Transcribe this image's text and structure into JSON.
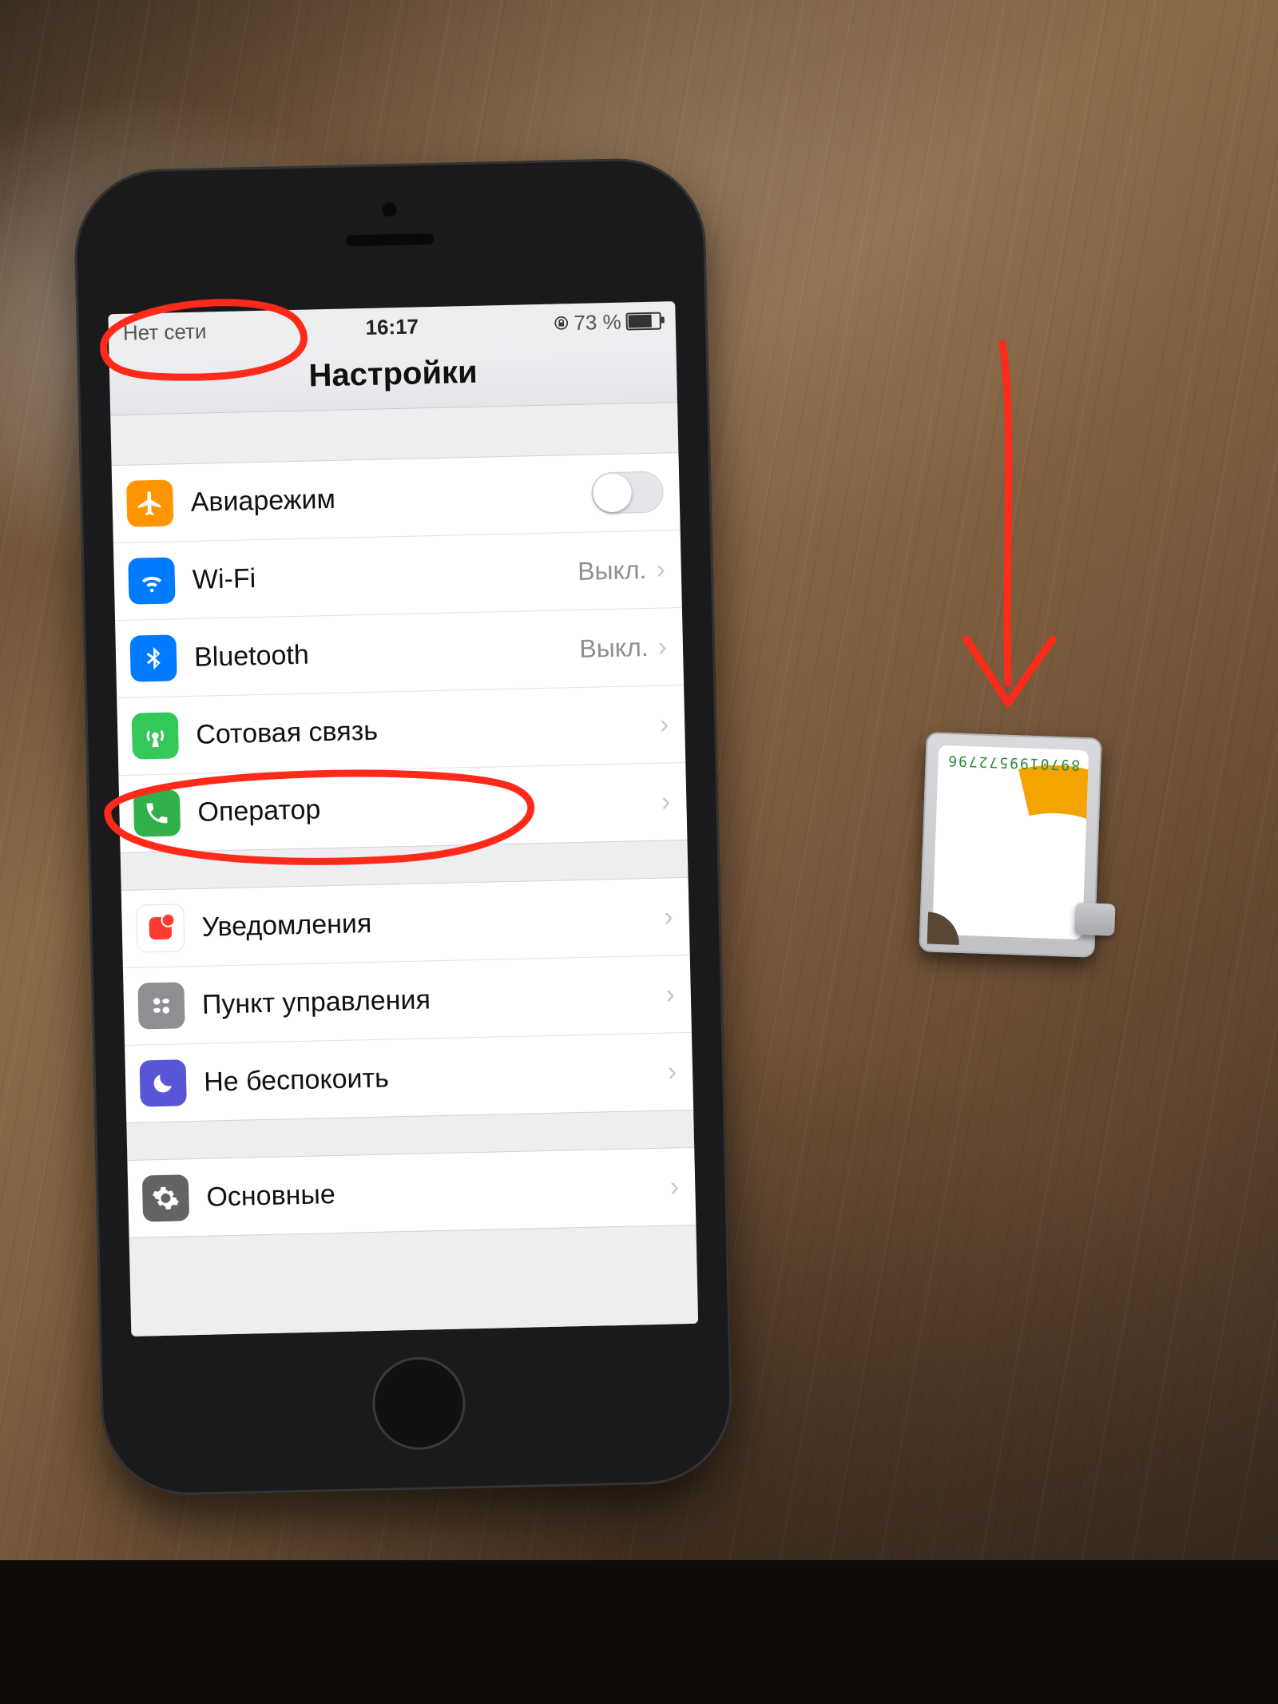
{
  "statusbar": {
    "carrier": "Нет сети",
    "time": "16:17",
    "battery_pct": "73 %"
  },
  "title": "Настройки",
  "groups": [
    {
      "rows": [
        {
          "key": "airplane",
          "label": "Авиарежим",
          "value": "",
          "type": "toggle"
        },
        {
          "key": "wifi",
          "label": "Wi-Fi",
          "value": "Выкл.",
          "type": "link"
        },
        {
          "key": "bluetooth",
          "label": "Bluetooth",
          "value": "Выкл.",
          "type": "link"
        },
        {
          "key": "cellular",
          "label": "Сотовая связь",
          "value": "",
          "type": "link"
        },
        {
          "key": "carrier",
          "label": "Оператор",
          "value": "",
          "type": "link"
        }
      ]
    },
    {
      "rows": [
        {
          "key": "notifications",
          "label": "Уведомления",
          "value": "",
          "type": "link"
        },
        {
          "key": "controlcenter",
          "label": "Пункт управления",
          "value": "",
          "type": "link"
        },
        {
          "key": "dnd",
          "label": "Не беспокоить",
          "value": "",
          "type": "link"
        }
      ]
    },
    {
      "rows": [
        {
          "key": "general",
          "label": "Основные",
          "value": "",
          "type": "link"
        }
      ]
    }
  ],
  "sim": {
    "digits": "8970199572796"
  },
  "annotations": {
    "circles": [
      "status-carrier",
      "row-carrier"
    ],
    "arrow_target": "sim-tray"
  }
}
